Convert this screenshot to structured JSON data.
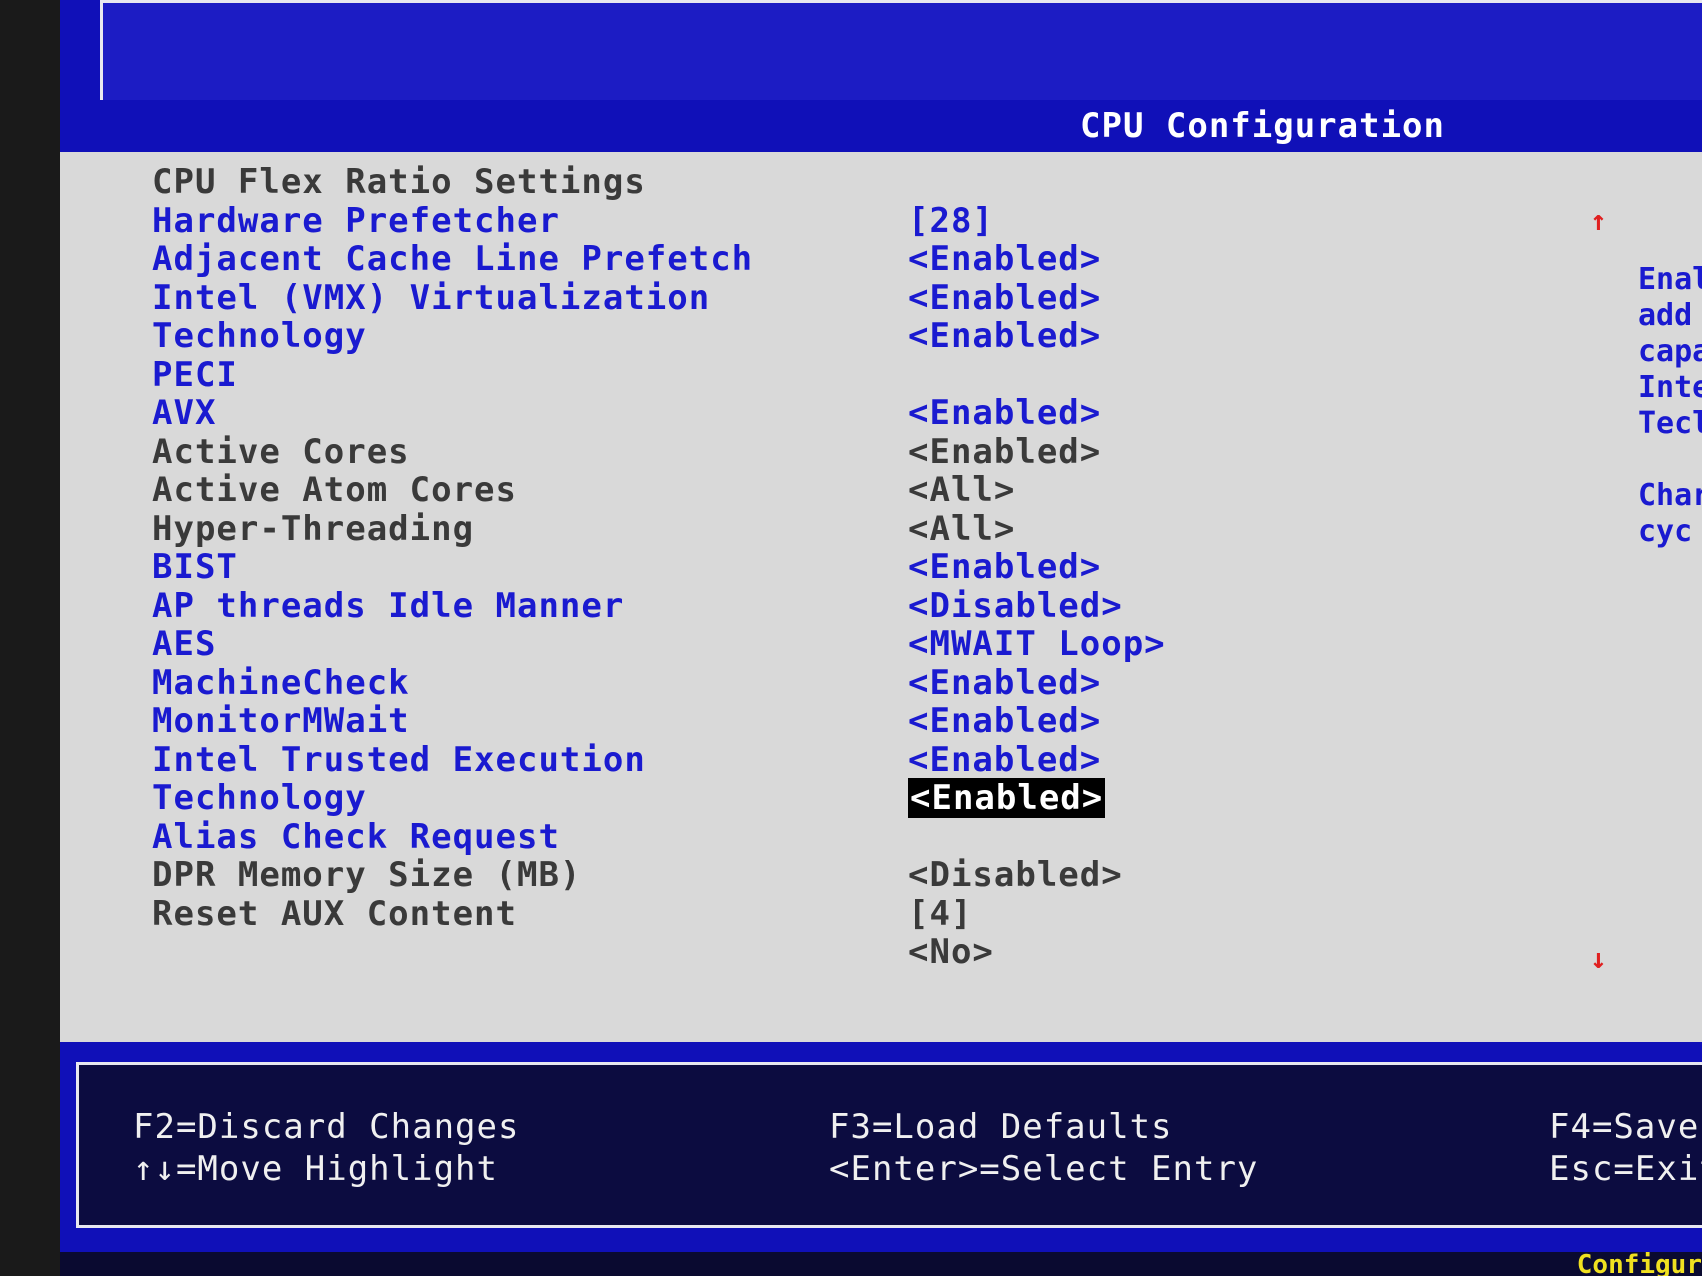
{
  "title": "CPU Configuration",
  "items": [
    {
      "label": "CPU Flex Ratio Settings",
      "value": "",
      "style": "gray"
    },
    {
      "label": "Hardware Prefetcher",
      "value": "[28]",
      "style": "blue"
    },
    {
      "label": "Adjacent Cache Line Prefetch",
      "value": "<Enabled>",
      "style": "blue"
    },
    {
      "label": "Intel (VMX) Virtualization",
      "value": "<Enabled>",
      "style": "blue"
    },
    {
      "label": "Technology",
      "value": "<Enabled>",
      "style": "blue"
    },
    {
      "label": "PECI",
      "value": "",
      "style": "blue"
    },
    {
      "label": "AVX",
      "value": "<Enabled>",
      "style": "blue"
    },
    {
      "label": "Active Cores",
      "value": "<Enabled>",
      "style": "gray"
    },
    {
      "label": "Active Atom Cores",
      "value": "<All>",
      "style": "gray"
    },
    {
      "label": "Hyper-Threading",
      "value": "<All>",
      "style": "gray"
    },
    {
      "label": "BIST",
      "value": "<Enabled>",
      "style": "blue"
    },
    {
      "label": "AP threads Idle Manner",
      "value": "<Disabled>",
      "style": "blue"
    },
    {
      "label": "AES",
      "value": "<MWAIT Loop>",
      "style": "blue"
    },
    {
      "label": "MachineCheck",
      "value": "<Enabled>",
      "style": "blue"
    },
    {
      "label": "MonitorMWait",
      "value": "<Enabled>",
      "style": "blue"
    },
    {
      "label": "Intel Trusted Execution",
      "value": "<Enabled>",
      "style": "blue"
    },
    {
      "label": "Technology",
      "value": "<Enabled>",
      "style": "blue",
      "highlight": true
    },
    {
      "label": "Alias Check Request",
      "value": "",
      "style": "blue"
    },
    {
      "label": "DPR Memory Size (MB)",
      "value": "<Disabled>",
      "style": "gray"
    },
    {
      "label": "Reset AUX Content",
      "value": "[4]",
      "style": "gray"
    },
    {
      "label": "",
      "value": "<No>",
      "style": "gray"
    }
  ],
  "help_lines": [
    "Enal",
    "add",
    "capa",
    "Inte",
    "Tecl",
    "",
    "Char",
    "cyc"
  ],
  "scroll_up": "↑",
  "scroll_down": "↓",
  "footer": {
    "f2": "F2=Discard Changes",
    "move": "↑↓=Move Highlight",
    "f3": "F3=Load Defaults",
    "enter": "<Enter>=Select Entry",
    "f4": "F4=Save",
    "esc": "Esc=Exit"
  },
  "corner": "Configur",
  "colors": {
    "frame_blue": "#1010b8",
    "item_blue": "#1a1ad0",
    "item_gray": "#3a3a3a",
    "content_bg": "#d9d9d9",
    "highlight_bg": "#000000",
    "arrow_red": "#e02020",
    "corner_yellow": "#f0e020"
  }
}
